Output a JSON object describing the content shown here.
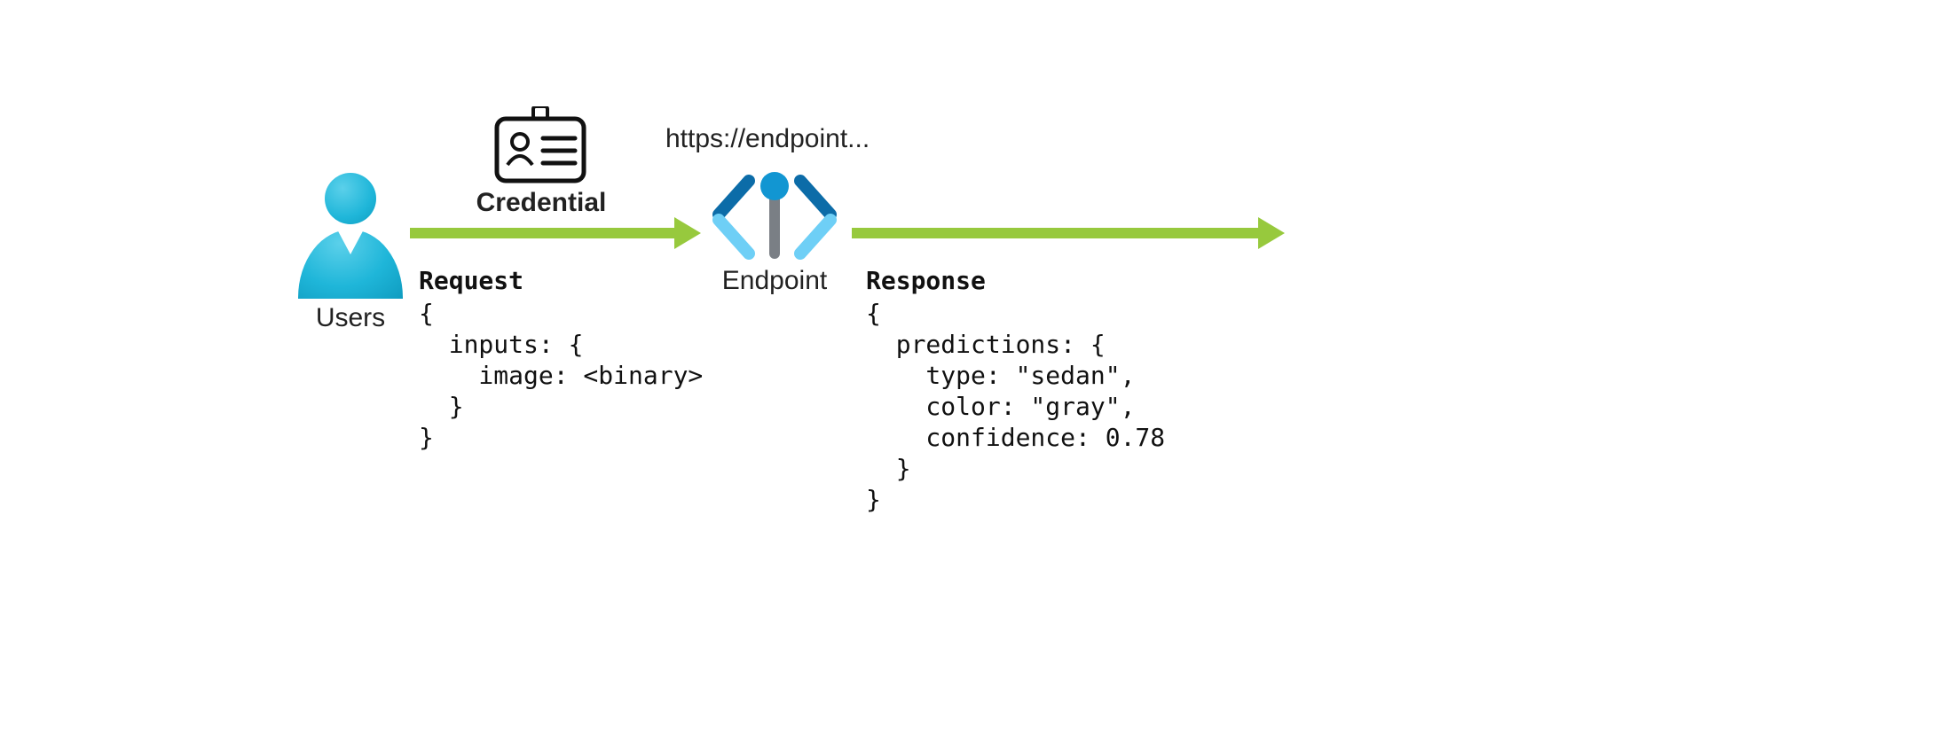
{
  "users_label": "Users",
  "credential_label": "Credential",
  "endpoint_url": "https://endpoint...",
  "endpoint_label": "Endpoint",
  "request": {
    "title": "Request",
    "body": "{\n  inputs: {\n    image: <binary>\n  }\n}"
  },
  "response": {
    "title": "Response",
    "body": "{\n  predictions: {\n    type: \"sedan\",\n    color: \"gray\",\n    confidence: 0.78\n  }\n}"
  },
  "colors": {
    "arrow": "#97c93d",
    "endpoint_dark": "#0c6ca8",
    "endpoint_light": "#6ecff6"
  }
}
